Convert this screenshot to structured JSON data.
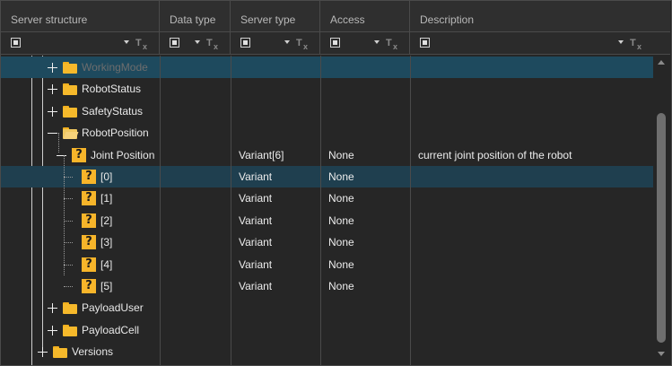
{
  "columns": [
    {
      "label": "Server structure"
    },
    {
      "label": "Data type"
    },
    {
      "label": "Server type"
    },
    {
      "label": "Access"
    },
    {
      "label": "Description"
    }
  ],
  "filter_icon": "filter-clear-icon",
  "tree": [
    {
      "label": "WorkingMode",
      "icon": "folder-icon",
      "expander": "plus",
      "level": 2,
      "faded": true,
      "server_type": "",
      "access": "",
      "description": ""
    },
    {
      "label": "RobotStatus",
      "icon": "folder-icon",
      "expander": "plus",
      "level": 2,
      "server_type": "",
      "access": "",
      "description": ""
    },
    {
      "label": "SafetyStatus",
      "icon": "folder-icon",
      "expander": "plus",
      "level": 2,
      "server_type": "",
      "access": "",
      "description": ""
    },
    {
      "label": "RobotPosition",
      "icon": "folder-open-icon",
      "expander": "minus",
      "level": 2,
      "server_type": "",
      "access": "",
      "description": ""
    },
    {
      "label": "Joint Position",
      "icon": "question-icon",
      "expander": "minus",
      "level": 3,
      "server_type": "Variant[6]",
      "access": "None",
      "description": "current joint position of the robot"
    },
    {
      "label": "[0]",
      "icon": "question-icon",
      "expander": "",
      "level": 4,
      "server_type": "Variant",
      "access": "None",
      "description": ""
    },
    {
      "label": "[1]",
      "icon": "question-icon",
      "expander": "",
      "level": 4,
      "server_type": "Variant",
      "access": "None",
      "description": ""
    },
    {
      "label": "[2]",
      "icon": "question-icon",
      "expander": "",
      "level": 4,
      "server_type": "Variant",
      "access": "None",
      "description": ""
    },
    {
      "label": "[3]",
      "icon": "question-icon",
      "expander": "",
      "level": 4,
      "server_type": "Variant",
      "access": "None",
      "description": ""
    },
    {
      "label": "[4]",
      "icon": "question-icon",
      "expander": "",
      "level": 4,
      "server_type": "Variant",
      "access": "None",
      "description": ""
    },
    {
      "label": "[5]",
      "icon": "question-icon",
      "expander": "",
      "level": 4,
      "server_type": "Variant",
      "access": "None",
      "description": ""
    },
    {
      "label": "PayloadUser",
      "icon": "folder-icon",
      "expander": "plus",
      "level": 2,
      "server_type": "",
      "access": "",
      "description": ""
    },
    {
      "label": "PayloadCell",
      "icon": "folder-icon",
      "expander": "plus",
      "level": 2,
      "server_type": "",
      "access": "",
      "description": ""
    },
    {
      "label": "Versions",
      "icon": "folder-icon",
      "expander": "plus",
      "level": 1,
      "server_type": "",
      "access": "",
      "description": ""
    }
  ],
  "selected_row": 0,
  "current_row": 5,
  "colors": {
    "selection": "#1e4a5e",
    "folder": "#f6b92b",
    "question": "#f7b52a"
  }
}
